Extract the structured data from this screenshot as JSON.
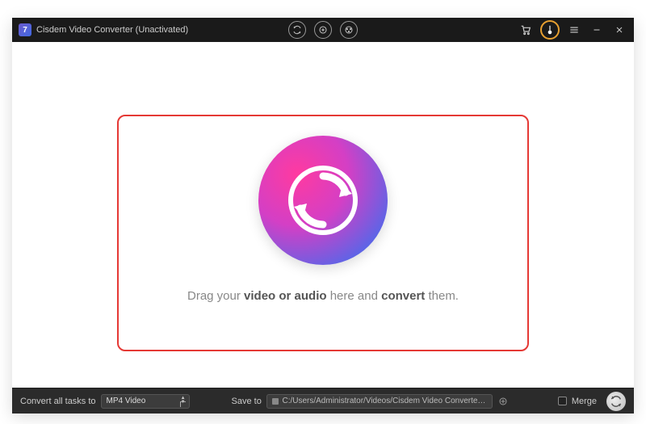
{
  "titlebar": {
    "app_glyph": "7",
    "title": "Cisdem Video Converter (Unactivated)"
  },
  "dropzone": {
    "text_prefix": "Drag your ",
    "text_bold1": "video or audio",
    "text_mid": " here and ",
    "text_bold2": "convert",
    "text_suffix": " them."
  },
  "bottombar": {
    "convert_label": "Convert all tasks to",
    "format_selected": "MP4 Video",
    "save_label": "Save to",
    "save_path": "C:/Users/Administrator/Videos/Cisdem Video Converter/Converted",
    "merge_label": "Merge"
  }
}
